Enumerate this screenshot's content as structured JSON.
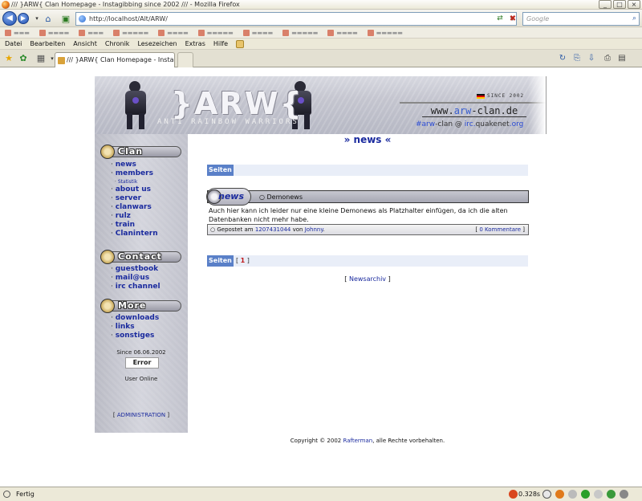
{
  "window": {
    "title": "/// }ARW{ Clan Homepage - Instagibbing since 2002 /// - Mozilla Firefox"
  },
  "navbar": {
    "url": "http://localhost/Alt/ARW/",
    "search_placeholder": "Google"
  },
  "menubar": {
    "items": [
      "Datei",
      "Bearbeiten",
      "Ansicht",
      "Chronik",
      "Lesezeichen",
      "Extras",
      "Hilfe"
    ]
  },
  "tab": {
    "title": "/// }ARW{ Clan Homepage - Instagibb..."
  },
  "banner": {
    "logo": "}ARW{",
    "subtitle": "ANTI RAINBOW WARRIORS",
    "since": "SINCE 2002",
    "site_prefix": "www.",
    "site_arw": "arw",
    "site_suffix": "-clan.de",
    "irc_channel": "#arw",
    "irc_mid": "-clan @ ",
    "irc_host": "irc.",
    "irc_network": "quakenet",
    "irc_tld": ".org"
  },
  "sidebar": {
    "clan": {
      "heading": "Clan",
      "items": [
        "news",
        "members",
        "about us",
        "server",
        "clanwars",
        "rulz",
        "train",
        "Clanintern"
      ],
      "subitem": "Statistik"
    },
    "contact": {
      "heading": "Contact",
      "items": [
        "guestbook",
        "mail@us",
        "irc channel"
      ]
    },
    "more": {
      "heading": "More",
      "items": [
        "downloads",
        "links",
        "sonstiges"
      ]
    },
    "since_date": "Since 06.06.2002",
    "counter": "Error",
    "user_online": "User Online",
    "admin_open": "[",
    "admin_label": "ADMINISTRATION",
    "admin_close": "]"
  },
  "main": {
    "title": "» news «",
    "seiten_label": "Seiten",
    "pages_open": "[",
    "current_page": "1",
    "pages_close": "]",
    "news": {
      "badge": "news",
      "headline": "○ Demonews",
      "body": "Auch hier kann ich leider nur eine kleine Demonews als Platzhalter einfügen, da ich die alten Datenbanken nicht mehr habe.",
      "posted_prefix": "○ Gepostet am",
      "timestamp": "1207431044",
      "by": "von",
      "author": "Johnny",
      "posted_suffix": ".",
      "comments_open": "[",
      "comments": "0 Kommentare",
      "comments_close": "]"
    },
    "archive_open": "[",
    "archive": "Newsarchiv",
    "archive_close": "]",
    "copyright_prefix": "Copyright © 2002",
    "copyright_author": "Rafterman",
    "copyright_suffix": ", alle Rechte vorbehalten."
  },
  "statusbar": {
    "text": "Fertig",
    "timing": "0.328s"
  }
}
